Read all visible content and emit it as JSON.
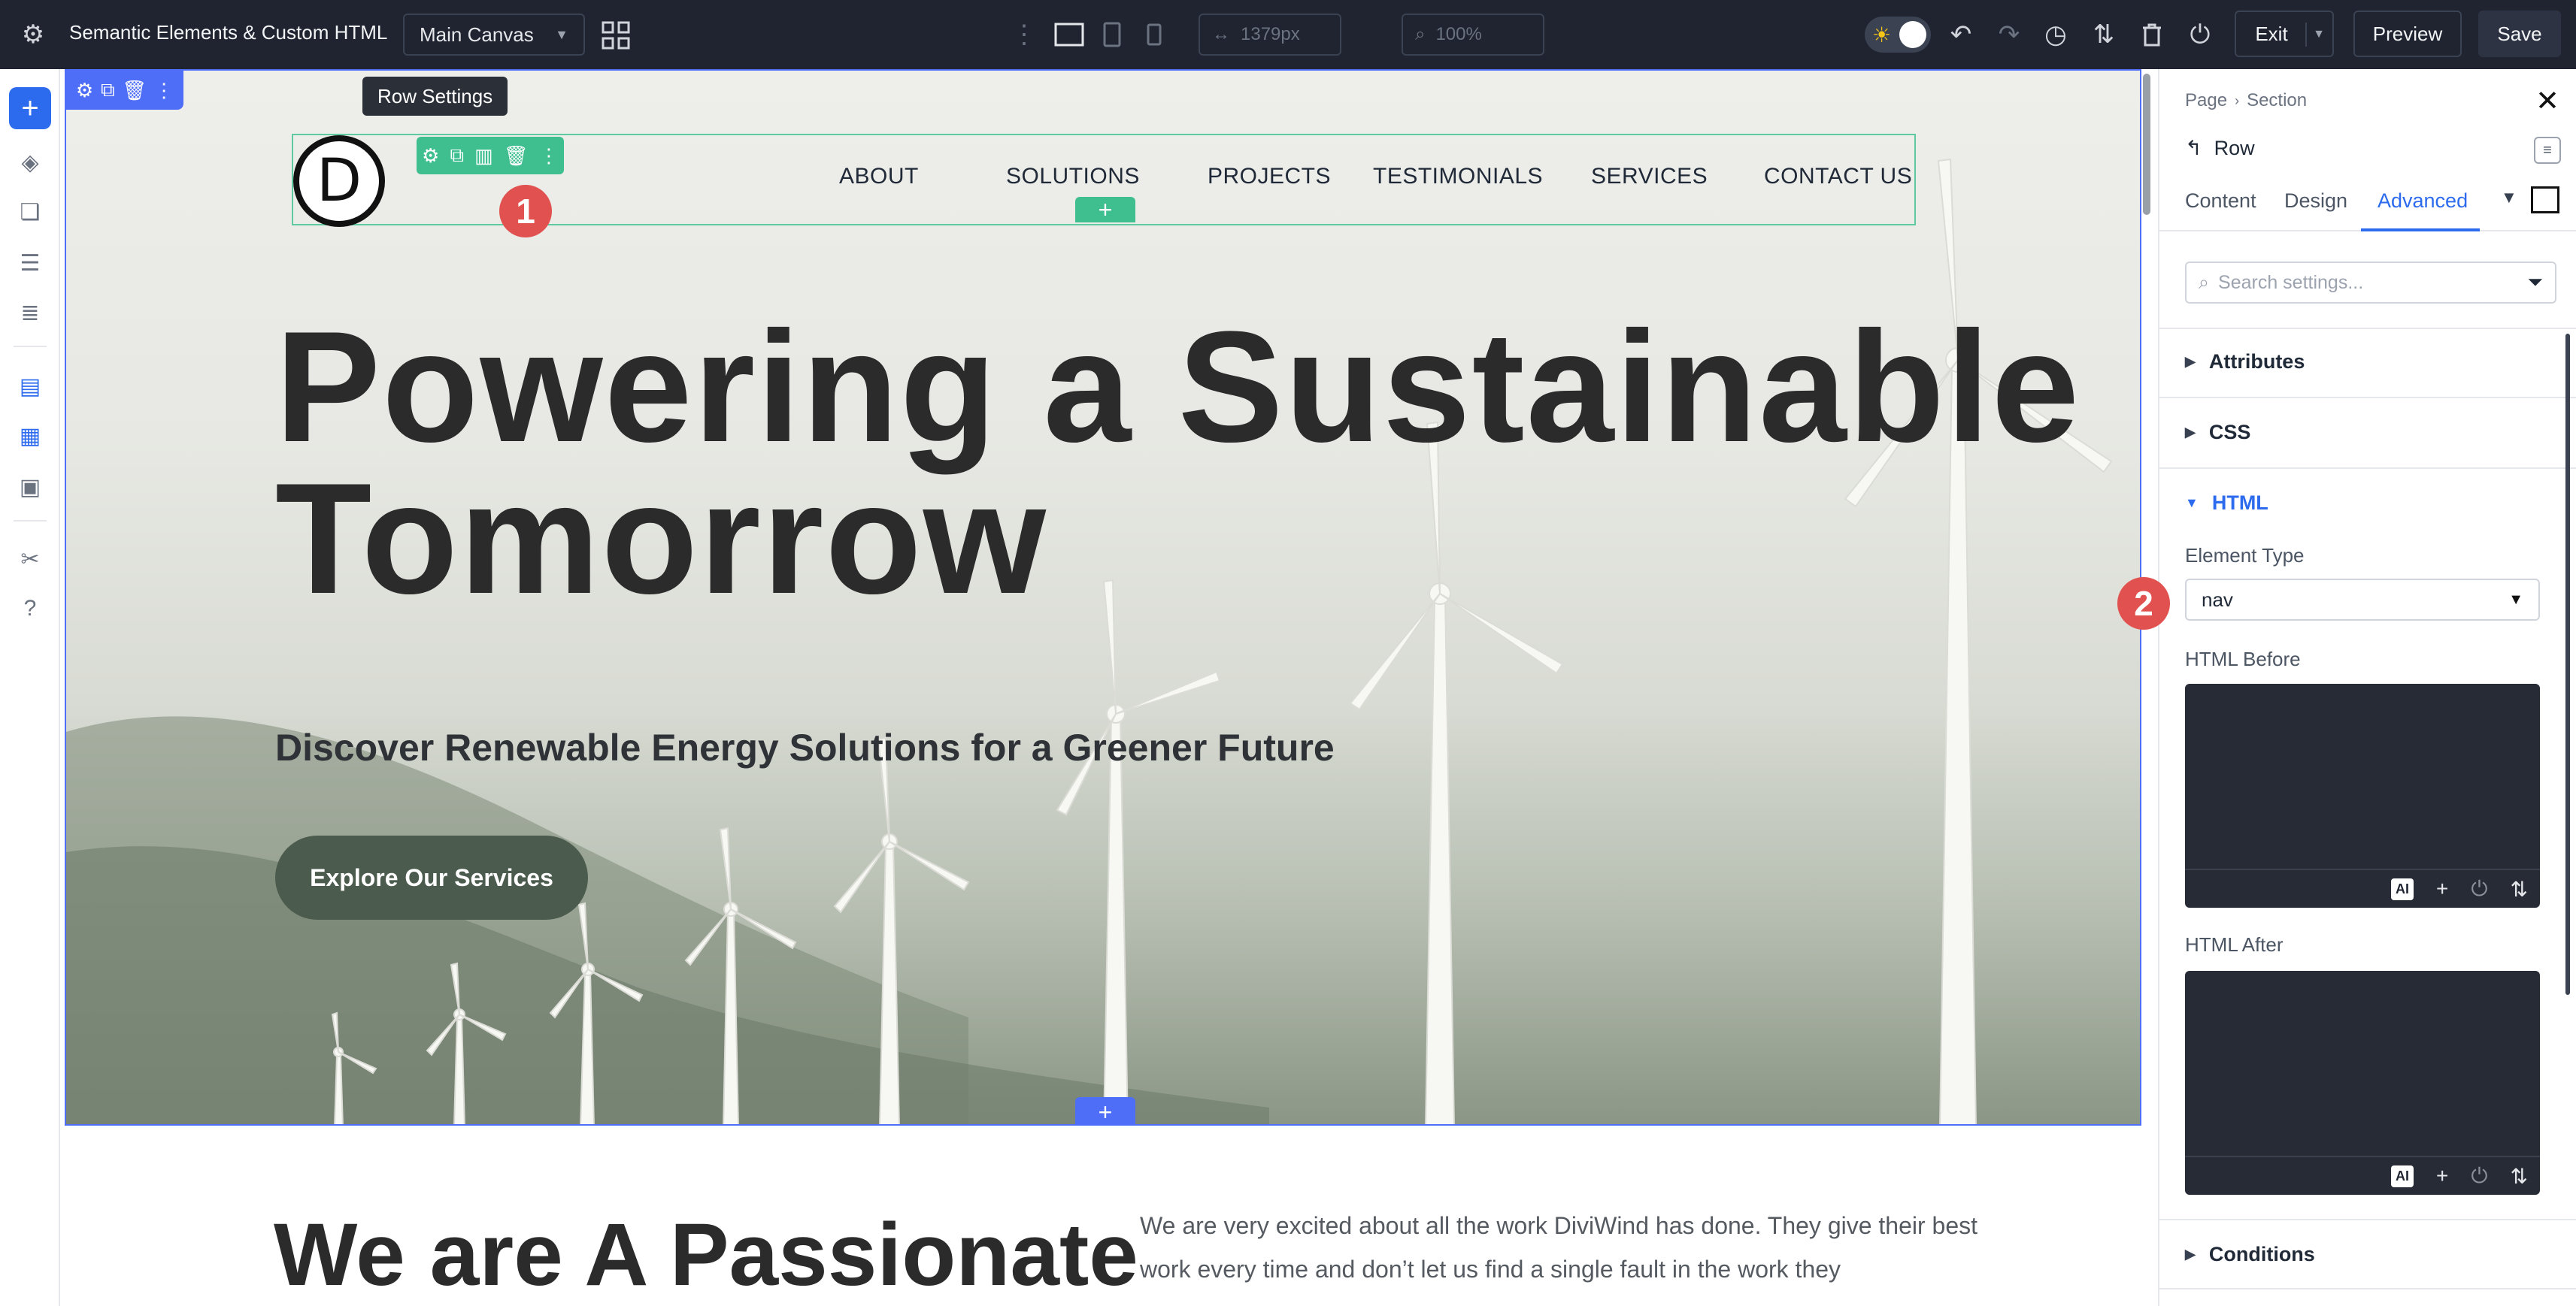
{
  "topbar": {
    "title": "Semantic Elements & Custom HTML",
    "canvas_select": "Main Canvas",
    "width_value": "1379px",
    "zoom_value": "100%",
    "exit_label": "Exit",
    "preview_label": "Preview",
    "save_label": "Save"
  },
  "canvas": {
    "tooltip": "Row Settings",
    "logo_letter": "D",
    "nav": [
      "ABOUT",
      "SOLUTIONS",
      "PROJECTS",
      "TESTIMONIALS",
      "SERVICES",
      "CONTACT US"
    ],
    "badge_1": "1",
    "hero_title_line1": "Powering a Sustainable",
    "hero_title_line2": "Tomorrow",
    "hero_subtitle": "Discover Renewable Energy Solutions for a Greener Future",
    "hero_cta": "Explore Our Services",
    "about_title": "We are A Passionate",
    "about_text": "We are very excited about all the work DiviWind has done. They give their best work every time and don’t let us find a single fault in the work they"
  },
  "panel": {
    "breadcrumb_page": "Page",
    "breadcrumb_section": "Section",
    "title": "Row",
    "tabs": [
      "Content",
      "Design",
      "Advanced"
    ],
    "active_tab": "Advanced",
    "search_placeholder": "Search settings...",
    "sections": {
      "attributes": "Attributes",
      "css": "CSS",
      "html": "HTML",
      "conditions": "Conditions"
    },
    "element_type_label": "Element Type",
    "element_type_value": "nav",
    "html_before_label": "HTML Before",
    "html_after_label": "HTML After",
    "ai_label": "AI",
    "badge_2": "2"
  },
  "colors": {
    "accent_blue": "#2c6bed",
    "row_green": "#3fbf8f",
    "badge_red": "#e0514f",
    "toolbar_dark": "#1f2430",
    "cta_green": "#4b5b4d"
  }
}
